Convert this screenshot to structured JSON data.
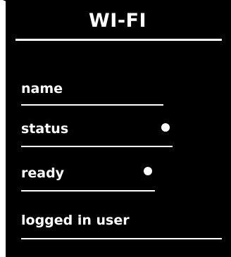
{
  "header": {
    "title": "WI-FI"
  },
  "items": [
    {
      "label": "name"
    },
    {
      "label": "status"
    },
    {
      "label": "ready"
    },
    {
      "label": "logged in user"
    }
  ],
  "colors": {
    "background": "#000000",
    "foreground": "#ffffff"
  }
}
